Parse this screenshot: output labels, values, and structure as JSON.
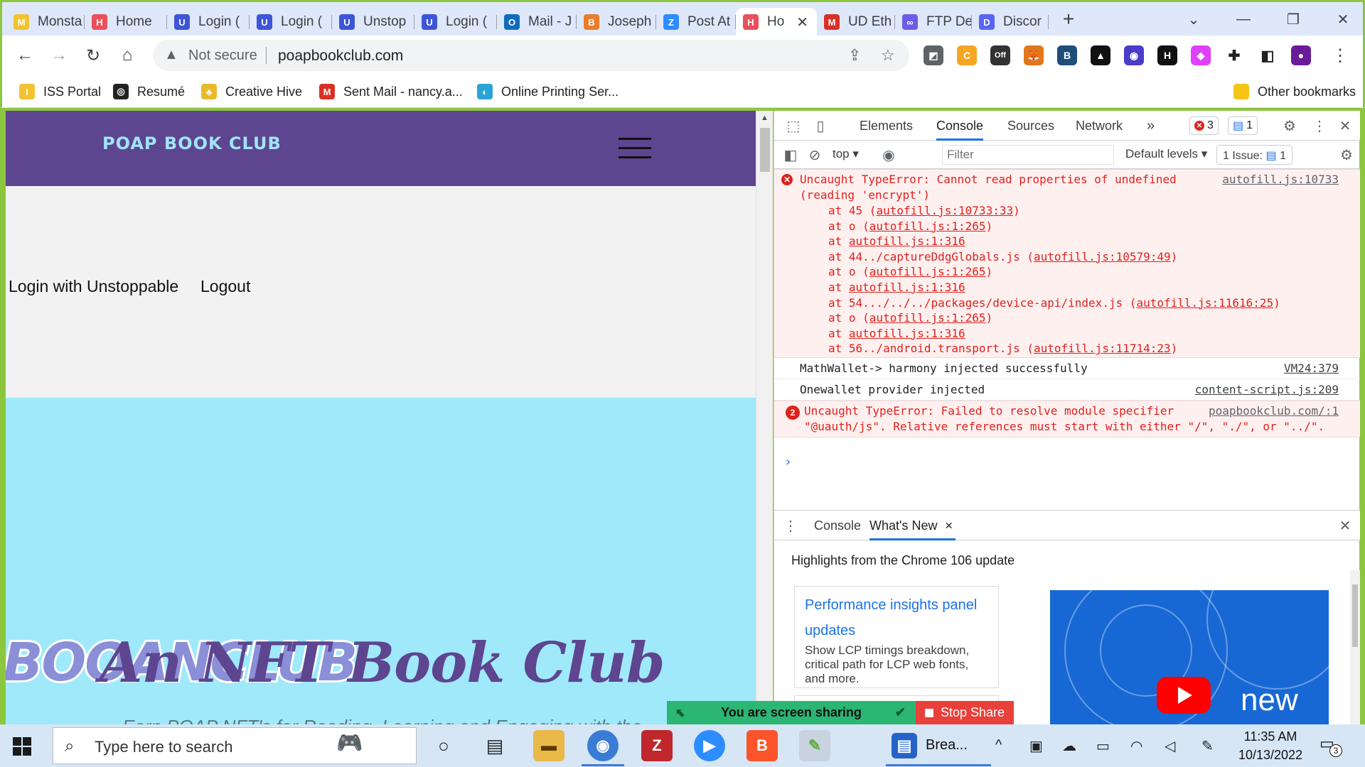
{
  "browser": {
    "tabs": [
      {
        "title": "Monsta",
        "color": "#f2c230",
        "glyph": "M"
      },
      {
        "title": "Home",
        "color": "#e8505b",
        "glyph": "H"
      },
      {
        "title": "Login (",
        "color": "#3d55d6",
        "glyph": "U"
      },
      {
        "title": "Login (",
        "color": "#3d55d6",
        "glyph": "U"
      },
      {
        "title": "Unstop",
        "color": "#3d55d6",
        "glyph": "U"
      },
      {
        "title": "Login (",
        "color": "#3d55d6",
        "glyph": "U"
      },
      {
        "title": "Mail - J",
        "color": "#0f6cbd",
        "glyph": "O"
      },
      {
        "title": "Joseph",
        "color": "#e87d2b",
        "glyph": "B"
      },
      {
        "title": "Post At",
        "color": "#2d8cff",
        "glyph": "Z"
      },
      {
        "title": "Ho",
        "color": "#e8505b",
        "glyph": "H",
        "active": true
      },
      {
        "title": "UD Eth",
        "color": "#d93025",
        "glyph": "M"
      },
      {
        "title": "FTP De",
        "color": "#6c5ce7",
        "glyph": "∞"
      },
      {
        "title": "Discor",
        "color": "#5865f2",
        "glyph": "D"
      }
    ],
    "new_tab": "+",
    "window_controls": {
      "tab_search": "⌄",
      "minimize": "—",
      "restore": "❐",
      "close": "✕"
    },
    "tab_close": "✕"
  },
  "toolbar": {
    "back": "←",
    "forward": "→",
    "reload": "↻",
    "home": "⌂",
    "security_label": "Not secure",
    "url": "poapbookclub.com",
    "share_icon": "⇪",
    "star_icon": "☆",
    "extensions": [
      {
        "name": "ext-a",
        "color": "#5f6368",
        "glyph": "◩"
      },
      {
        "name": "ext-coupon",
        "color": "#f5a623",
        "glyph": "C"
      },
      {
        "name": "ext-off",
        "color": "#333333",
        "glyph": "Off"
      },
      {
        "name": "ext-metamask",
        "color": "#e2761b",
        "glyph": "🦊"
      },
      {
        "name": "ext-b",
        "color": "#1f4e79",
        "glyph": "B"
      },
      {
        "name": "ext-c",
        "color": "#111111",
        "glyph": "▲"
      },
      {
        "name": "ext-d",
        "color": "#4a3cc9",
        "glyph": "◉"
      },
      {
        "name": "ext-e",
        "color": "#111111",
        "glyph": "H"
      },
      {
        "name": "ext-f",
        "color": "#e040fb",
        "glyph": "◆"
      },
      {
        "name": "extensions-puzzle",
        "color": "#ffffff",
        "glyph": "✚"
      },
      {
        "name": "side-panel",
        "color": "#ffffff",
        "glyph": "◧"
      },
      {
        "name": "profile",
        "color": "#6a1b9a",
        "glyph": "●"
      }
    ],
    "menu": "⋮"
  },
  "bookmarks": [
    {
      "label": "ISS Portal",
      "color": "#f2c230",
      "glyph": "I"
    },
    {
      "label": "Resumé",
      "color": "#222222",
      "glyph": "◎"
    },
    {
      "label": "Creative Hive",
      "color": "#e8b92b",
      "glyph": "♣"
    },
    {
      "label": "Sent Mail - nancy.a...",
      "color": "#d93025",
      "glyph": "M"
    },
    {
      "label": "Online Printing Ser...",
      "color": "#2ba3d6",
      "glyph": "◐"
    }
  ],
  "other_bookmarks": "Other bookmarks",
  "site": {
    "logo": "POAP BOOK CLUB",
    "nav_links": [
      "Login with Unstoppable",
      "Logout"
    ],
    "hero_ghost": "BOOANCLUB",
    "hero_title": "An NFT Book Club",
    "hero_subtitle": "Earn POAP NFT's for Reading, Learning and Engaging with the"
  },
  "devtools": {
    "tabs": [
      "Elements",
      "Console",
      "Sources",
      "Network"
    ],
    "active_tab": "Console",
    "more": "»",
    "error_count": "3",
    "message_count": "1",
    "context": "top",
    "filter_placeholder": "Filter",
    "levels": "Default levels",
    "issues": "1 Issue:",
    "issues_count": "1",
    "messages": {
      "err1_l1": "Uncaught TypeError: Cannot read properties of undefined",
      "err1_l2": "(reading 'encrypt')",
      "err1_src": "autofill.js:10733",
      "stack": [
        {
          "pre": "at 45 (",
          "link": "autofill.js:10733:33",
          "post": ")"
        },
        {
          "pre": "at o (",
          "link": "autofill.js:1:265",
          "post": ")"
        },
        {
          "pre": "at ",
          "link": "autofill.js:1:316",
          "post": ""
        },
        {
          "pre": "at 44../captureDdgGlobals.js (",
          "link": "autofill.js:10579:49",
          "post": ")"
        },
        {
          "pre": "at o (",
          "link": "autofill.js:1:265",
          "post": ")"
        },
        {
          "pre": "at ",
          "link": "autofill.js:1:316",
          "post": ""
        },
        {
          "pre": "at 54.../../../packages/device-api/index.js (",
          "link": "autofill.js:11616:25",
          "post": ")"
        },
        {
          "pre": "at o (",
          "link": "autofill.js:1:265",
          "post": ")"
        },
        {
          "pre": "at ",
          "link": "autofill.js:1:316",
          "post": ""
        },
        {
          "pre": "at 56../android.transport.js (",
          "link": "autofill.js:11714:23",
          "post": ")"
        }
      ],
      "log1": "MathWallet-> harmony injected successfully",
      "log1_src": "VM24:379",
      "log2": "Onewallet provider injected",
      "log2_src": "content-script.js:209",
      "err2_count": "2",
      "err2_l1": "Uncaught TypeError: Failed to resolve module specifier",
      "err2_l2": "\"@uauth/js\". Relative references must start with either \"/\", \"./\", or \"../\".",
      "err2_src": "poapbookclub.com/:1"
    },
    "prompt": "›",
    "drawer_tabs": [
      "Console",
      "What's New"
    ],
    "drawer_active": "What's New",
    "whats_new": {
      "heading": "Highlights from the Chrome 106 update",
      "card_title": "Performance insights panel updates",
      "card_desc": "Show LCP timings breakdown, critical path for LCP web fonts, and more.",
      "image_text": "new"
    }
  },
  "screen_share": {
    "message": "You are screen sharing",
    "stop": "Stop Share"
  },
  "taskbar": {
    "search_placeholder": "Type here to search",
    "running_app_label": "Brea...",
    "time": "11:35 AM",
    "date": "10/13/2022",
    "notification_count": "3"
  }
}
